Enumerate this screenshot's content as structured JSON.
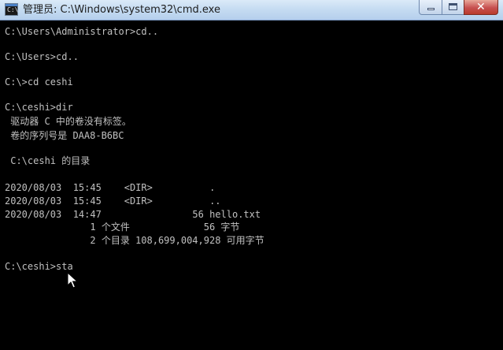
{
  "window": {
    "title": "管理员: C:\\Windows\\system32\\cmd.exe",
    "icon": "cmd-console-icon",
    "buttons": {
      "minimize": "minimize-icon",
      "maximize": "maximize-icon",
      "close": "✕"
    }
  },
  "console": {
    "lines": [
      "C:\\Users\\Administrator>cd..",
      "C:\\Users>cd..",
      "C:\\>cd ceshi",
      "C:\\ceshi>dir",
      " 驱动器 C 中的卷没有标签。",
      " 卷的序列号是 DAA8-B6BC",
      " C:\\ceshi 的目录",
      "2020/08/03  15:45    <DIR>          .",
      "2020/08/03  15:45    <DIR>          ..",
      "2020/08/03  14:47                56 hello.txt",
      "               1 个文件             56 字节",
      "               2 个目录 108,699,004,928 可用字节",
      "C:\\ceshi>sta"
    ],
    "colors": {
      "background": "#000000",
      "text": "#c0c0c0"
    }
  }
}
